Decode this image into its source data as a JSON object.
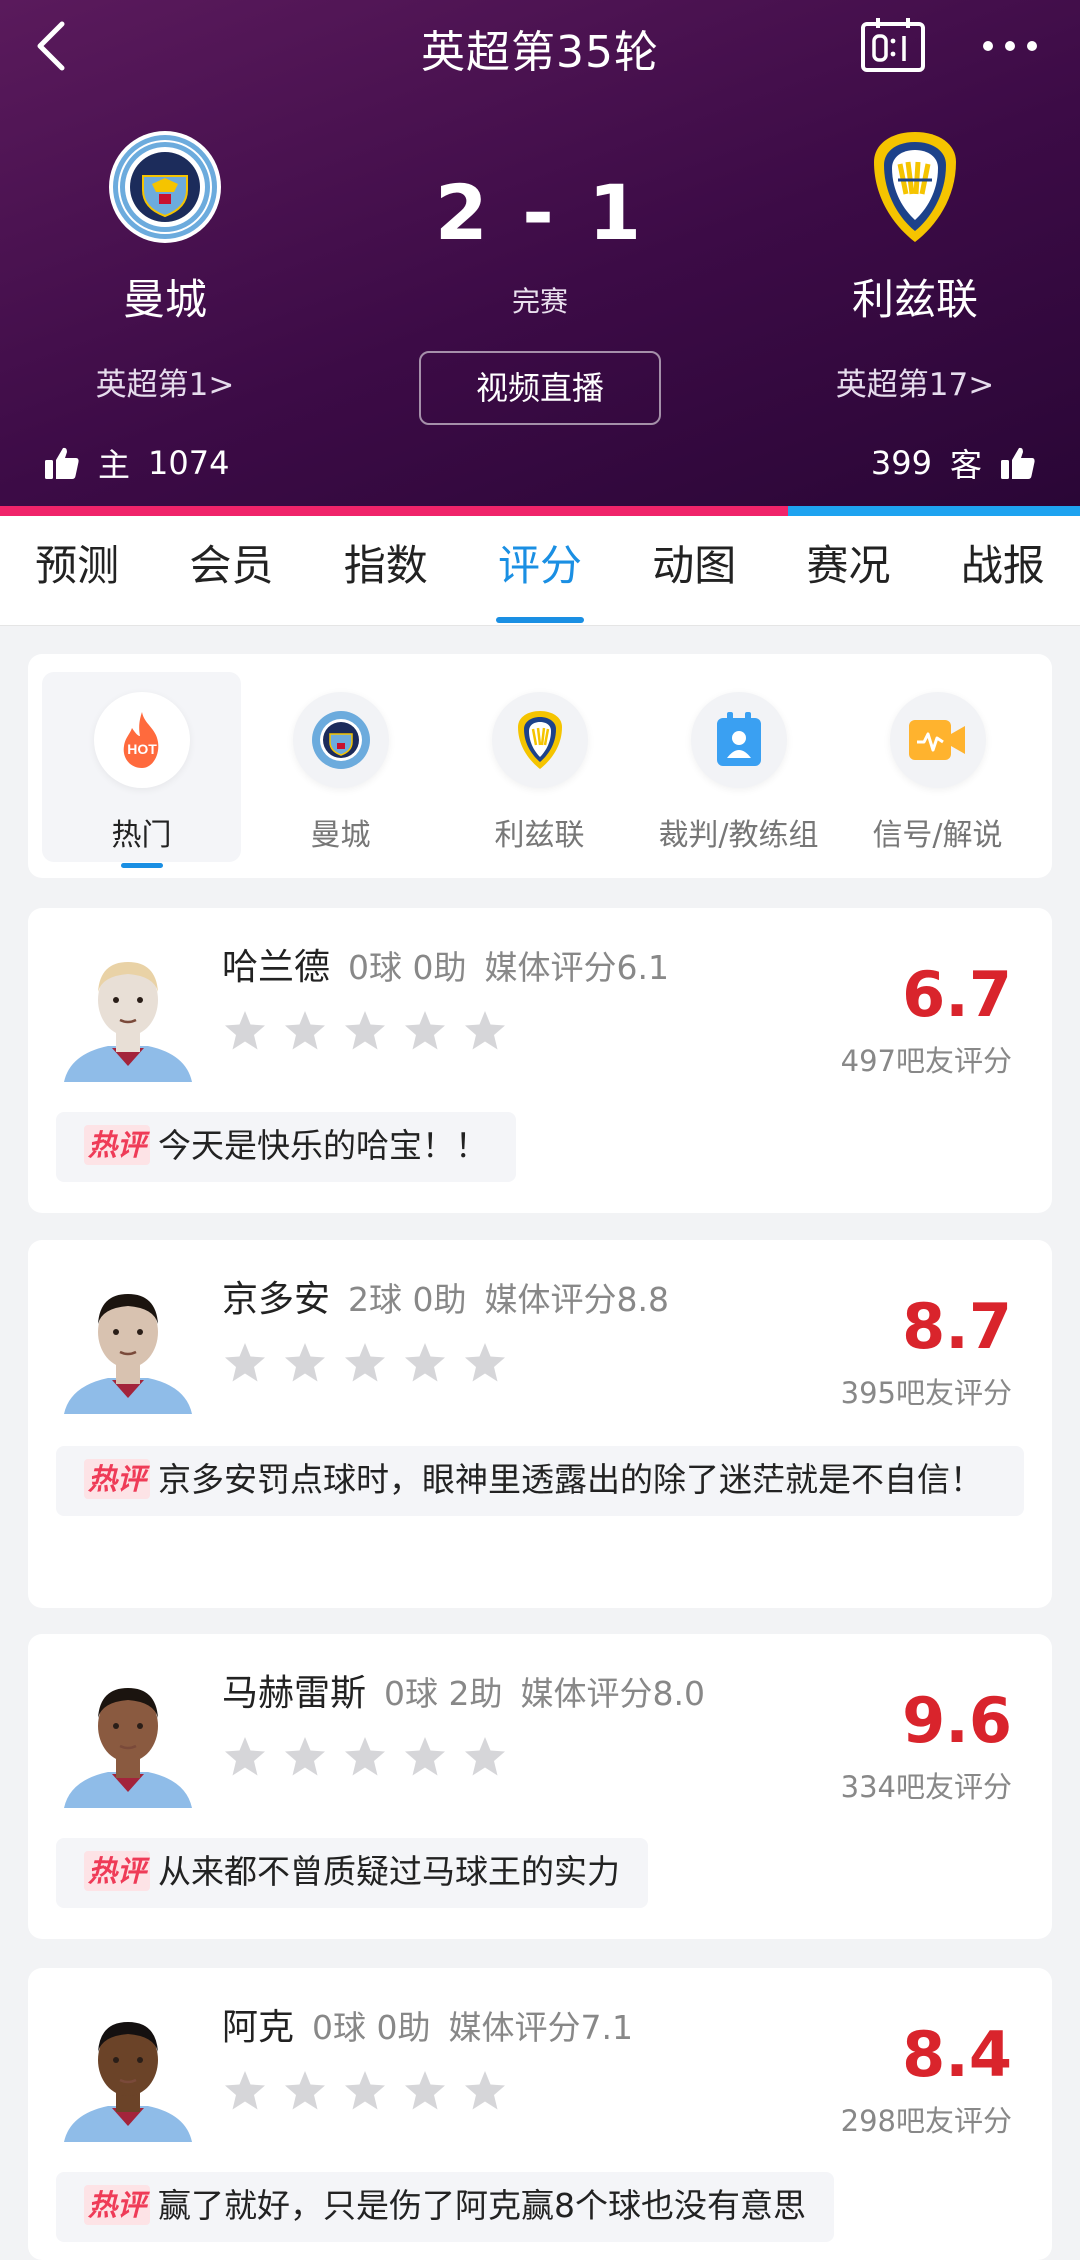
{
  "header": {
    "round_title": "英超第35轮",
    "home": {
      "name": "曼城",
      "rank": "英超第1>",
      "likes_label": "主",
      "likes": "1074"
    },
    "away": {
      "name": "利兹联",
      "rank": "英超第17>",
      "likes_label": "客",
      "likes": "399"
    },
    "score": "2 - 1",
    "status": "完赛",
    "video_button": "视频直播",
    "support_home_fraction": 0.73,
    "colors": {
      "home_bar": "#f0246a",
      "away_bar": "#1ea3f0"
    }
  },
  "tabs": [
    "预测",
    "会员",
    "指数",
    "评分",
    "动图",
    "赛况",
    "战报"
  ],
  "active_tab": "评分",
  "categories": [
    {
      "label": "热门",
      "icon": "hot-icon",
      "hot_text": "HOT"
    },
    {
      "label": "曼城",
      "icon": "man-city-crest-icon"
    },
    {
      "label": "利兹联",
      "icon": "leeds-crest-icon"
    },
    {
      "label": "裁判/教练组",
      "icon": "referee-badge-icon"
    },
    {
      "label": "信号/解说",
      "icon": "signal-video-icon"
    }
  ],
  "hot_tag": "热评",
  "players": [
    {
      "name": "哈兰德",
      "stats": "0球 0助",
      "media": "媒体评分6.1",
      "rating": "6.7",
      "raters": "497吧友评分",
      "comment": "今天是快乐的哈宝！！"
    },
    {
      "name": "京多安",
      "stats": "2球 0助",
      "media": "媒体评分8.8",
      "rating": "8.7",
      "raters": "395吧友评分",
      "comment": "京多安罚点球时，眼神里透露出的除了迷茫就是不自信！"
    },
    {
      "name": "马赫雷斯",
      "stats": "0球 2助",
      "media": "媒体评分8.0",
      "rating": "9.6",
      "raters": "334吧友评分",
      "comment": "从来都不曾质疑过马球王的实力"
    },
    {
      "name": "阿克",
      "stats": "0球 0助",
      "media": "媒体评分7.1",
      "rating": "8.4",
      "raters": "298吧友评分",
      "comment": "赢了就好，只是伤了阿克赢8个球也没有意思"
    }
  ]
}
